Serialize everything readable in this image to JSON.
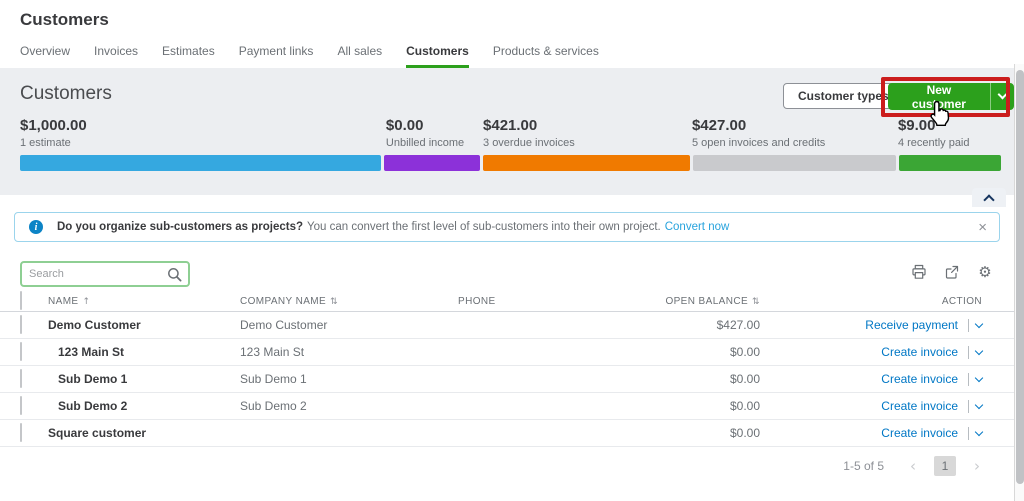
{
  "page": {
    "title": "Customers"
  },
  "tabs": [
    {
      "label": "Overview",
      "active": false
    },
    {
      "label": "Invoices",
      "active": false
    },
    {
      "label": "Estimates",
      "active": false
    },
    {
      "label": "Payment links",
      "active": false
    },
    {
      "label": "All sales",
      "active": false
    },
    {
      "label": "Customers",
      "active": true
    },
    {
      "label": "Products & services",
      "active": false
    }
  ],
  "header": {
    "title": "Customers",
    "customer_types_label": "Customer types",
    "new_customer_label": "New customer"
  },
  "stats": [
    {
      "amount": "$1,000.00",
      "label": "1 estimate",
      "color": "#35a8e0",
      "width_pct": 37.3
    },
    {
      "amount": "$0.00",
      "label": "Unbilled income",
      "color": "#8c31d9",
      "width_pct": 9.9
    },
    {
      "amount": "$421.00",
      "label": "3 overdue invoices",
      "color": "#f07a00",
      "width_pct": 21.3
    },
    {
      "amount": "$427.00",
      "label": "5 open invoices and credits",
      "color": "#c9cacd",
      "width_pct": 21.0
    },
    {
      "amount": "$9.00",
      "label": "4 recently paid",
      "color": "#3ba635",
      "width_pct": 10.5
    }
  ],
  "banner": {
    "bold_text": "Do you organize sub-customers as projects?",
    "text": "You can convert the first level of sub-customers into their own project.",
    "link_label": "Convert now",
    "close_glyph": "×"
  },
  "search": {
    "placeholder": "Search"
  },
  "table": {
    "columns": [
      {
        "label": "NAME",
        "sort": "asc"
      },
      {
        "label": "COMPANY NAME",
        "sort": "both"
      },
      {
        "label": "PHONE",
        "sort": null
      },
      {
        "label": "OPEN BALANCE",
        "sort": "both"
      },
      {
        "label": "ACTION",
        "sort": null
      }
    ],
    "rows": [
      {
        "name": "Demo Customer",
        "company": "Demo Customer",
        "phone": "",
        "balance": "$427.00",
        "action": "Receive payment",
        "indent": false
      },
      {
        "name": "123 Main St",
        "company": "123 Main St",
        "phone": "",
        "balance": "$0.00",
        "action": "Create invoice",
        "indent": true
      },
      {
        "name": "Sub Demo 1",
        "company": "Sub Demo 1",
        "phone": "",
        "balance": "$0.00",
        "action": "Create invoice",
        "indent": true
      },
      {
        "name": "Sub Demo 2",
        "company": "Sub Demo 2",
        "phone": "",
        "balance": "$0.00",
        "action": "Create invoice",
        "indent": true
      },
      {
        "name": "Square customer",
        "company": "",
        "phone": "",
        "balance": "$0.00",
        "action": "Create invoice",
        "indent": false
      }
    ]
  },
  "pagination": {
    "range_label": "1-5 of 5",
    "prev_glyph": "‹",
    "current_page": "1",
    "next_glyph": "›"
  },
  "icons": {
    "sort_asc": "↑",
    "sort_both": "⇅",
    "gear": "⚙"
  },
  "colors": {
    "accent_green": "#2ca01c",
    "link_blue": "#0077c5",
    "banner_link_blue": "#27a3dd",
    "annotation_red": "#cb1d1d",
    "section_bg": "#eceef1"
  }
}
